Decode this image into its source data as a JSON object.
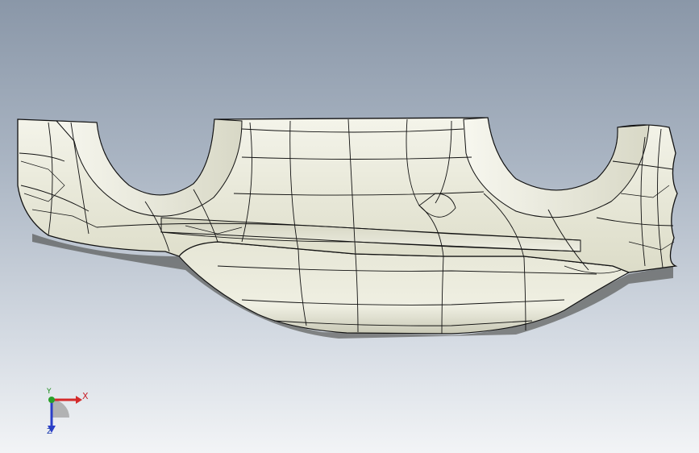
{
  "viewport": {
    "background_top": "#8a97a8",
    "background_bottom": "#f2f4f6",
    "model_color": "#ededdf",
    "edge_color": "#111111"
  },
  "triad": {
    "x_label": "X",
    "y_label": "Y",
    "z_label": "Z",
    "x_color": "#d42a2a",
    "y_color": "#2aa02a",
    "z_color": "#2a3fc8"
  }
}
